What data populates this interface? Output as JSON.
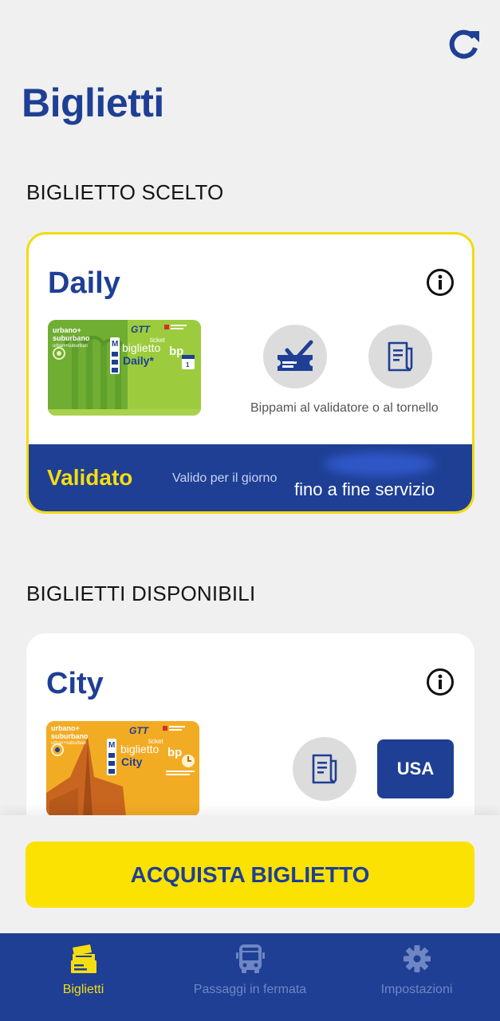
{
  "header": {
    "title": "Biglietti",
    "refresh_icon": "refresh-icon"
  },
  "selected_section": {
    "title": "BIGLIETTO SCELTO",
    "card": {
      "name": "Daily",
      "ticket_image": {
        "line1": "urbano+",
        "line2": "suburbano",
        "line3": "urban+suburban",
        "brand": "GTT",
        "ticket_word": "ticket",
        "product_main": "biglietto",
        "product_name": "Daily*",
        "bp_mark": "bp"
      },
      "validate_icon": "ticket-check-icon",
      "receipt_icon": "receipt-icon",
      "hint": "Bippami al validatore o al tornello",
      "status": "Validato",
      "valid_day_label": "Valido per il giorno",
      "valid_until": "fino a fine servizio"
    }
  },
  "available_section": {
    "title": "BIGLIETTI DISPONIBILI",
    "card": {
      "name": "City",
      "ticket_image": {
        "line1": "urbano+",
        "line2": "suburbano",
        "line3": "urban+suburban",
        "brand": "GTT",
        "ticket_word": "ticket",
        "product_main": "biglietto",
        "product_name": "City",
        "bp_mark": "bp"
      },
      "receipt_icon": "receipt-icon",
      "use_label": "USA"
    }
  },
  "buy_button": "ACQUISTA BIGLIETTO",
  "tabs": [
    {
      "label": "Biglietti",
      "icon": "tickets-icon",
      "active": true
    },
    {
      "label": "Passaggi in fermata",
      "icon": "bus-icon",
      "active": false
    },
    {
      "label": "Impostazioni",
      "icon": "gear-icon",
      "active": false
    }
  ],
  "colors": {
    "brand_blue": "#1e3f94",
    "accent_yellow": "#fbe203",
    "daily_green": "#8cc43a",
    "city_orange": "#f0a51e"
  }
}
